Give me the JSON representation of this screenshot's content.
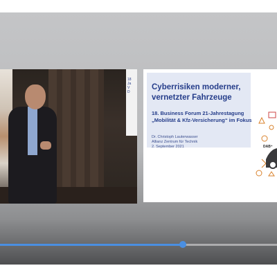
{
  "slide": {
    "title": "Cyberrisiken moderner, vernetzter Fahrzeuge",
    "subtitle": "18. Business Forum 21-Jahrestagung „Mobilität & Kfz-Versicherung“ im Fokus",
    "author": "Dr. Christoph Lauterwasser",
    "organization": "Allianz Zentrum für Technik",
    "date": "2. September 2021"
  },
  "video_slide_fragment": "18\nJa\nV\nD",
  "playback": {
    "progress_fraction": 0.66
  },
  "controls": {
    "rewind_icon": "replay-10-icon",
    "play_pause_icon": "pause-icon",
    "forward_icon": "forward-10-icon"
  },
  "colors": {
    "accent": "#4a8fe2",
    "slide_text": "#253d8a",
    "slide_box": "#e3e8f4"
  }
}
